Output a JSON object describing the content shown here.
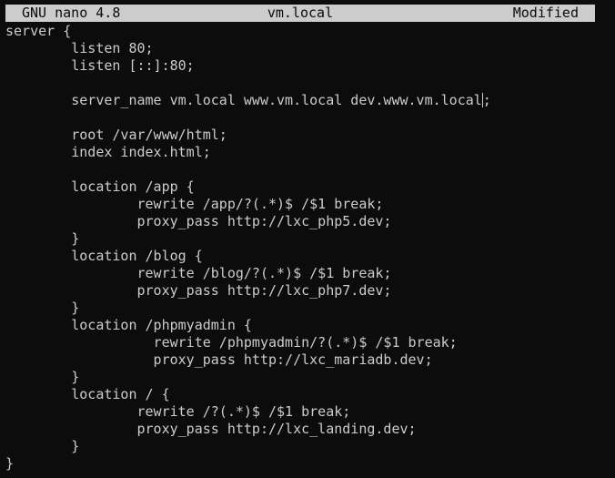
{
  "titlebar": {
    "app_name": "GNU nano 4.8",
    "file_name": "vm.local",
    "status": "Modified"
  },
  "editor": {
    "lines": [
      "server {",
      "        listen 80;",
      "        listen [::]:80;",
      "",
      "        server_name vm.local www.vm.local dev.www.vm.local",
      "",
      "        root /var/www/html;",
      "        index index.html;",
      "",
      "        location /app {",
      "                rewrite /app/?(.*)$ /$1 break;",
      "                proxy_pass http://lxc_php5.dev;",
      "        }",
      "        location /blog {",
      "                rewrite /blog/?(.*)$ /$1 break;",
      "                proxy_pass http://lxc_php7.dev;",
      "        }",
      "        location /phpmyadmin {",
      "                  rewrite /phpmyadmin/?(.*)$ /$1 break;",
      "                  proxy_pass http://lxc_mariadb.dev;",
      "        }",
      "        location / {",
      "                rewrite /?(.*)$ /$1 break;",
      "                proxy_pass http://lxc_landing.dev;",
      "        }",
      "}"
    ],
    "cursor_after_text": ";",
    "colors": {
      "background": "#0c0c0c",
      "text": "#cccccc",
      "titlebar_bg": "#cccccc",
      "titlebar_text": "#0c0c0c"
    }
  }
}
